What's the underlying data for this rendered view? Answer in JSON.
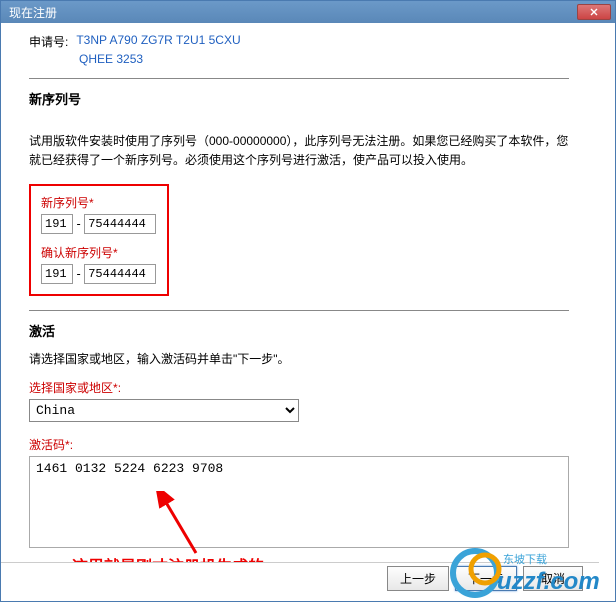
{
  "titlebar": {
    "title": "现在注册"
  },
  "request": {
    "label": "申请号:",
    "code_line1": "T3NP A790 ZG7R T2U1 5CXU",
    "code_line2": "QHEE 3253"
  },
  "new_serial": {
    "title": "新序列号",
    "desc": "试用版软件安装时使用了序列号（000-00000000），此序列号无法注册。如果您已经购买了本软件，您就已经获得了一个新序列号。必须使用这个序列号进行激活，使产品可以投入使用。",
    "field1_label": "新序列号",
    "field2_label": "确认新序列号",
    "serial_a": "191",
    "serial_b": "75444444"
  },
  "activate": {
    "title": "激活",
    "desc": "请选择国家或地区，输入激活码并单击\"下一步\"。",
    "country_label": "选择国家或地区",
    "country_value": "China",
    "code_label": "激活码",
    "code_value": "1461 0132 5224 6223 9708"
  },
  "annotation": "这里就是刚才注册机生成的",
  "buttons": {
    "prev": "上一步",
    "next": "下一步",
    "cancel": "取消"
  },
  "watermark": {
    "subtitle": "东坡下载",
    "url": "uzzf.com"
  }
}
